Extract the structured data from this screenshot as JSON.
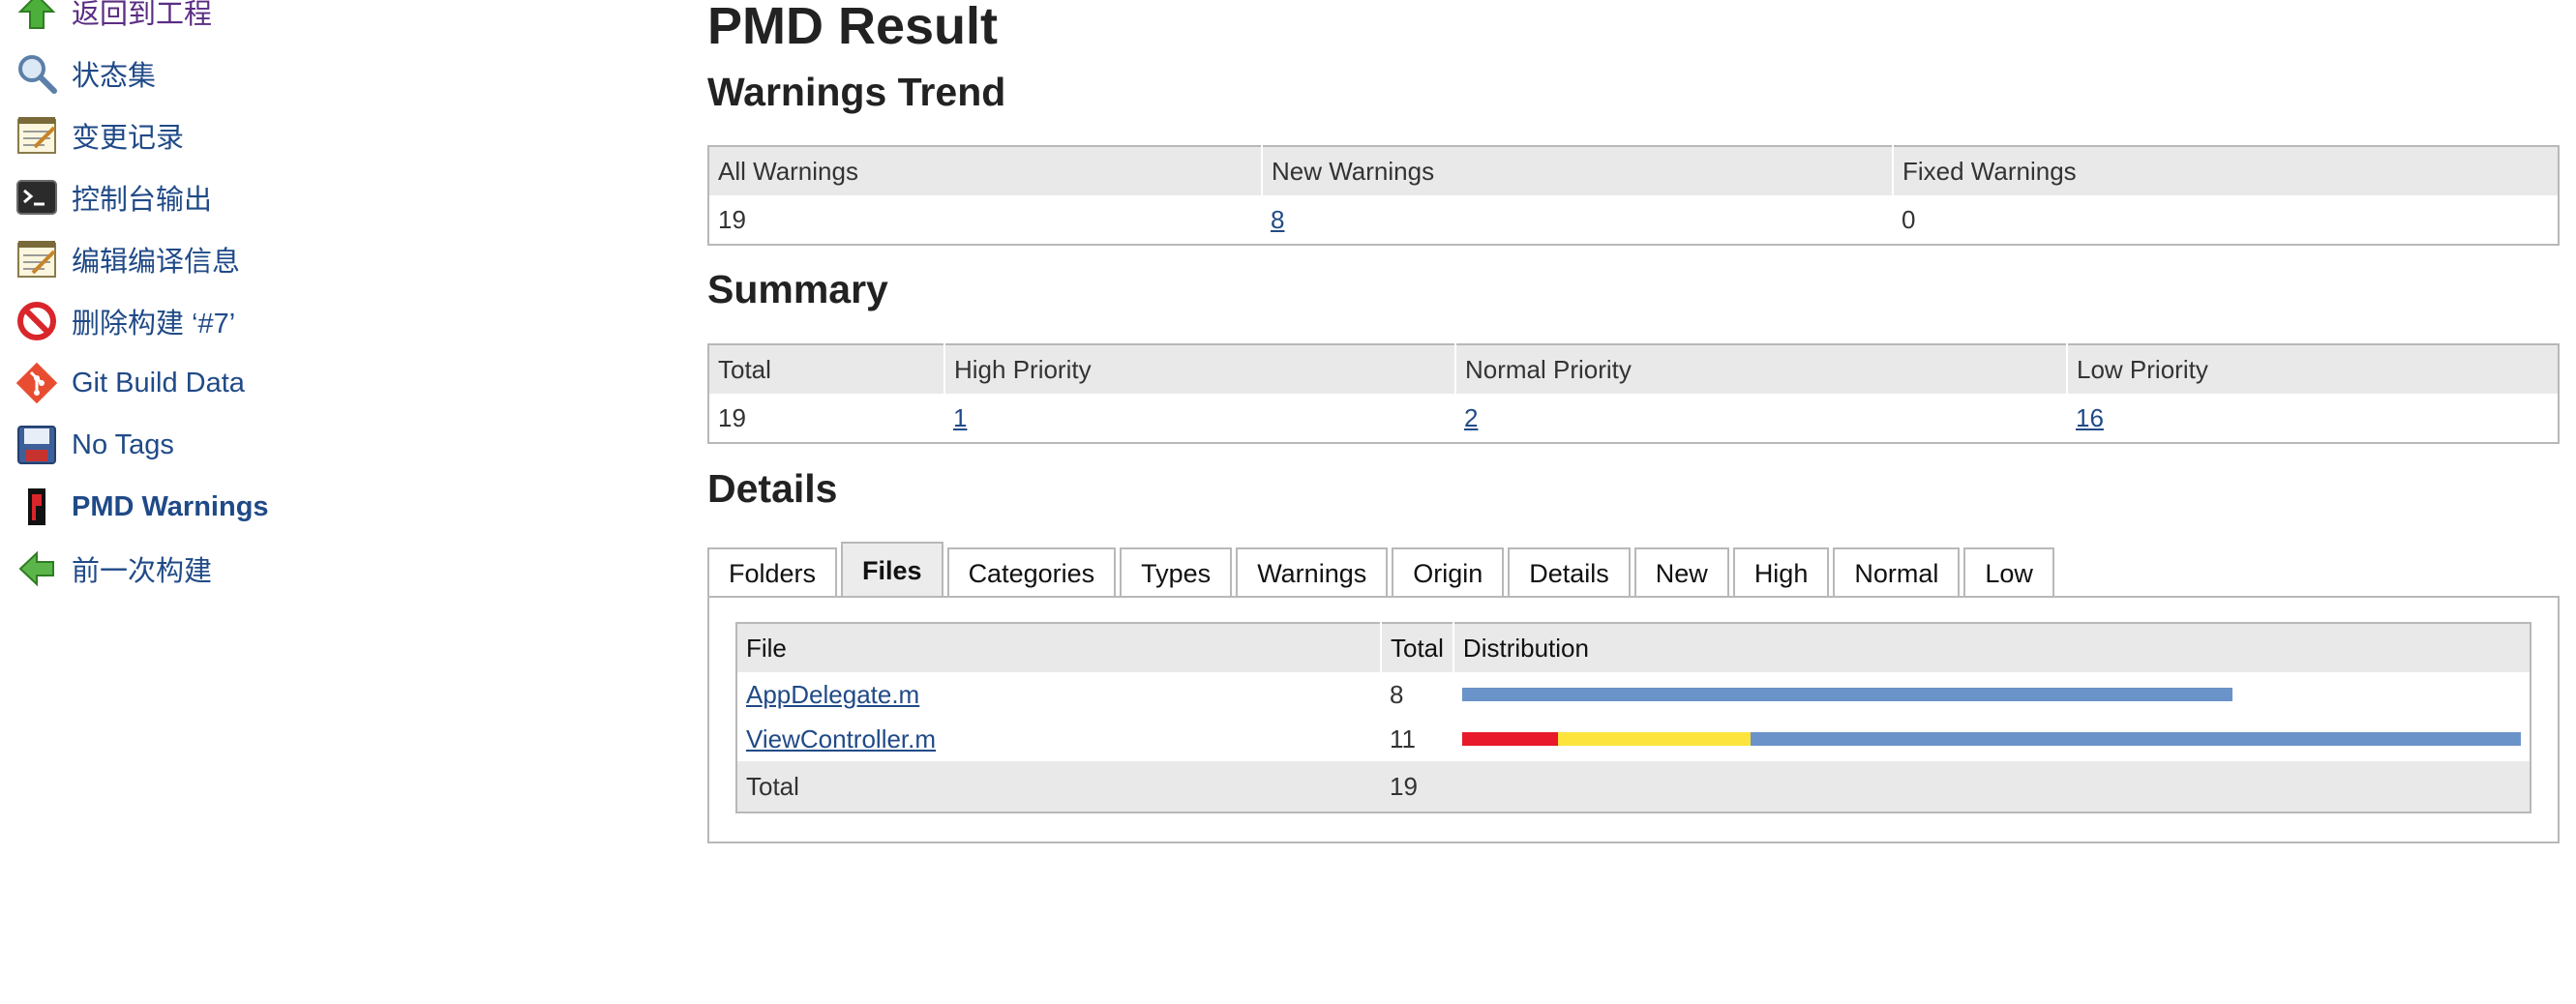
{
  "sidebar": {
    "items": [
      {
        "label": "返回到工程",
        "icon": "up-arrow-icon"
      },
      {
        "label": "状态集",
        "icon": "magnifier-icon"
      },
      {
        "label": "变更记录",
        "icon": "notepad-icon"
      },
      {
        "label": "控制台输出",
        "icon": "terminal-icon"
      },
      {
        "label": "编辑编译信息",
        "icon": "notepad-edit-icon"
      },
      {
        "label": "删除构建 ‘#7’",
        "icon": "no-entry-icon"
      },
      {
        "label": "Git Build Data",
        "icon": "git-icon"
      },
      {
        "label": "No Tags",
        "icon": "save-disk-icon"
      },
      {
        "label": "PMD Warnings",
        "icon": "pmd-icon"
      },
      {
        "label": "前一次构建",
        "icon": "left-arrow-icon"
      }
    ]
  },
  "page": {
    "title": "PMD Result"
  },
  "trend": {
    "title": "Warnings Trend",
    "headers": [
      "All Warnings",
      "New Warnings",
      "Fixed Warnings"
    ],
    "values": [
      "19",
      "8",
      "0"
    ]
  },
  "summary": {
    "title": "Summary",
    "headers": [
      "Total",
      "High Priority",
      "Normal Priority",
      "Low Priority"
    ],
    "values": [
      "19",
      "1",
      "2",
      "16"
    ]
  },
  "details": {
    "title": "Details",
    "tabs": [
      "Folders",
      "Files",
      "Categories",
      "Types",
      "Warnings",
      "Origin",
      "Details",
      "New",
      "High",
      "Normal",
      "Low"
    ],
    "active_tab": "Files",
    "files_table": {
      "headers": [
        "File",
        "Total",
        "Distribution"
      ],
      "rows": [
        {
          "file": "AppDelegate.m",
          "total": "8",
          "high": 0,
          "normal": 0,
          "low": 8
        },
        {
          "file": "ViewController.m",
          "total": "11",
          "high": 1,
          "normal": 2,
          "low": 8
        }
      ],
      "total_label": "Total",
      "total_value": "19",
      "max_total": 11
    }
  },
  "colors": {
    "high": "#e8192a",
    "normal": "#fce43c",
    "low": "#6a93c9",
    "link": "#204a87"
  }
}
